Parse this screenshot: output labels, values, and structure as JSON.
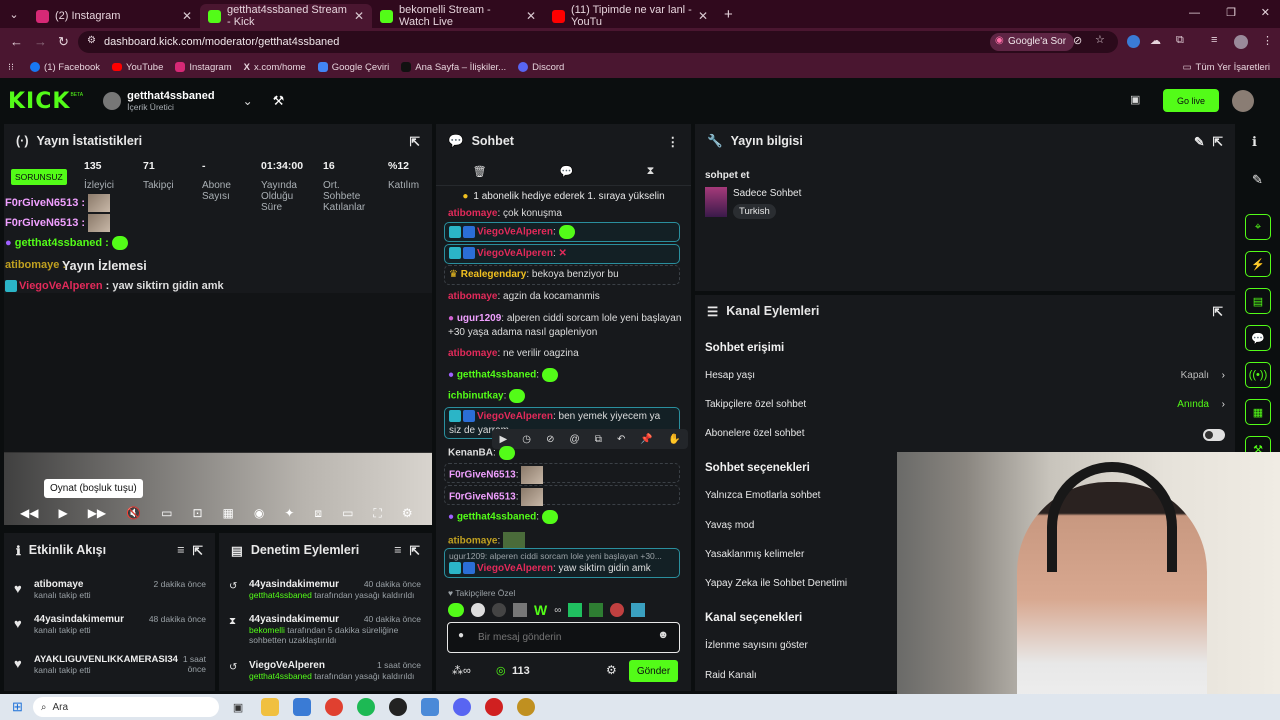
{
  "browser": {
    "tabs": [
      {
        "label": "(2) Instagram",
        "color": "#d62976"
      },
      {
        "label": "getthat4ssbaned Stream - Kick",
        "color": "#53fc18",
        "active": true
      },
      {
        "label": "bekomelli Stream - Watch Live",
        "color": "#53fc18"
      },
      {
        "label": "(11) Tipimde ne var lanl - YouTu",
        "color": "#ff0000"
      }
    ],
    "url": "dashboard.kick.com/moderator/getthat4ssbaned",
    "google_button": "Google'a Sor",
    "bookmarks": [
      "(1) Facebook",
      "YouTube",
      "Instagram",
      "x.com/home",
      "Google Çeviri",
      "Ana Sayfa – İlişkiler...",
      "Discord"
    ],
    "all_bookmarks": "Tüm Yer İşaretleri"
  },
  "header": {
    "logo": "KICK",
    "logo_sup": "BETA",
    "username": "getthat4ssbaned",
    "role": "İçerik Üretici",
    "go_live": "Go live"
  },
  "stats_panel": {
    "title": "Yayın İstatistikleri",
    "status": "SORUNSUZ",
    "stats": [
      {
        "value": "135",
        "label": "İzleyici"
      },
      {
        "value": "71",
        "label": "Takipçi"
      },
      {
        "value": "-",
        "label": "Abone Sayısı"
      },
      {
        "value": "01:34:00",
        "label": "Yayında Olduğu Süre"
      },
      {
        "value": "16",
        "label": "Ort. Sohbete Katılanlar"
      },
      {
        "value": "%12",
        "label": "Katılım"
      }
    ],
    "overlay_chat": [
      {
        "user": "F0rGiveN6513 :"
      },
      {
        "user": "F0rGiveN6513 :"
      },
      {
        "user": "getthat4ssbaned :"
      },
      {
        "user": "atibomaye :"
      },
      {
        "user": "ViegoVeAlperen",
        "text": ": yaw siktirn gidin amk"
      }
    ],
    "preview_title": "Yayın İzlemesi",
    "tooltip": "Oynat (boşluk tuşu)"
  },
  "chat": {
    "title": "Sohbet",
    "pinned": "1 abonelik hediye ederek 1. sıraya yükselin",
    "messages": [
      {
        "user": "atibomaye",
        "text": "çok konuşma"
      },
      {
        "user": "ViegoVeAlperen",
        "text": ""
      },
      {
        "user": "ViegoVeAlperen",
        "text": ""
      },
      {
        "user": "Realegendary",
        "text": "bekoya benziyor bu"
      },
      {
        "user": "atibomaye",
        "text": "agzin da kocamanmis"
      },
      {
        "user": "ugur1209",
        "text": "alperen ciddi sorcam lole yeni başlayan +30 yaşa adama nasıl gapleniyon"
      },
      {
        "user": "atibomaye",
        "text": "ne verilir oagzina"
      },
      {
        "user": "getthat4ssbaned",
        "text": ""
      },
      {
        "user": "ichbinutkay",
        "text": ""
      },
      {
        "user": "ViegoVeAlperen",
        "text": "ben yemek yiyecem ya siz de yarram"
      },
      {
        "user": "KenanBA",
        "text": ""
      },
      {
        "user": "F0rGiveN6513",
        "text": ""
      },
      {
        "user": "F0rGiveN6513",
        "text": ""
      },
      {
        "user": "getthat4ssbaned",
        "text": ""
      },
      {
        "user": "atibomaye",
        "text": ""
      },
      {
        "reply": "ugur1209: alperen ciddi sorcam lole yeni başlayan +30...",
        "user": "ViegoVeAlperen",
        "text": "yaw siktirn gidin amk"
      }
    ],
    "followers_only": "Takipçilere Özel",
    "placeholder": "Bir mesaj gönderin",
    "count": "113",
    "send": "Gönder"
  },
  "stream_info": {
    "title": "Yayın bilgisi",
    "stream_title": "sohpet et",
    "category": "Sadece Sohbet",
    "tag": "Turkish"
  },
  "channel_actions": {
    "title": "Kanal Eylemleri",
    "chat_access": "Sohbet erişimi",
    "account_age": "Hesap yaşı",
    "account_age_value": "Kapalı",
    "followers_chat": "Takipçilere özel sohbet",
    "followers_chat_value": "Anında",
    "subs_chat": "Abonelere özel sohbet",
    "chat_options": "Sohbet seçenekleri",
    "emotes_only": "Yalnızca Emotlarla sohbet",
    "slow_mode": "Yavaş mod",
    "banned_words": "Yasaklanmış kelimeler",
    "ai_moderation": "Yapay Zeka ile Sohbet Denetimi",
    "channel_options": "Kanal seçenekleri",
    "show_views": "İzlenme sayısını göster",
    "raid": "Raid Kanalı"
  },
  "activity": {
    "title": "Etkinlik Akışı",
    "items": [
      {
        "name": "atibomaye",
        "sub": "kanalı takip etti",
        "time": "2 dakika önce"
      },
      {
        "name": "44yasindakimemur",
        "sub": "kanalı takip etti",
        "time": "48 dakika önce"
      },
      {
        "name": "AYAKLIGUVENLIKKAMERASI34",
        "sub": "kanalı takip etti",
        "time": "1 saat önce"
      }
    ]
  },
  "moderation": {
    "title": "Denetim Eylemleri",
    "items": [
      {
        "name": "44yasindakimemur",
        "by": "getthat4ssbaned",
        "sub": "tarafından yasağı kaldırıldı",
        "time": "40 dakika önce"
      },
      {
        "name": "44yasindakimemur",
        "by": "bekomelli",
        "sub": "tarafından 5 dakika süreliğine sohbetten uzaklaştırıldı",
        "time": "40 dakika önce"
      },
      {
        "name": "ViegoVeAlperen",
        "by": "getthat4ssbaned",
        "sub": "tarafından yasağı kaldırıldı",
        "time": "1 saat önce"
      }
    ]
  },
  "taskbar": {
    "search": "Ara"
  }
}
